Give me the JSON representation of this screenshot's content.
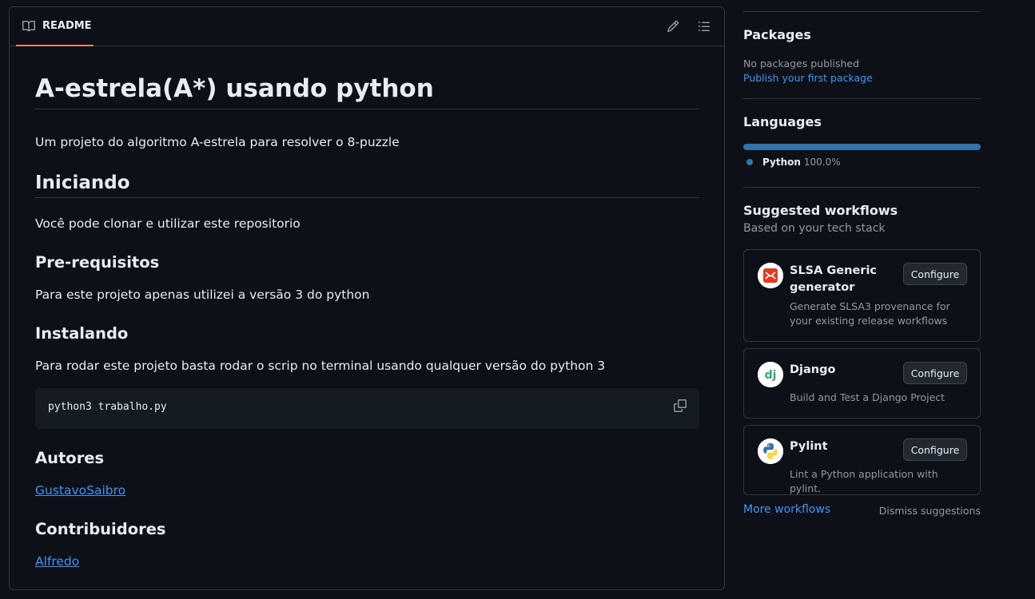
{
  "readme": {
    "tab_label": "README",
    "title": "A-estrela(A*) usando python",
    "intro": "Um projeto do algoritmo A-estrela para resolver o 8-puzzle",
    "h_iniciando": "Iniciando",
    "p_iniciando": "Você pode clonar e utilizar este repositorio",
    "h_prereq": "Pre-requisitos",
    "p_prereq": "Para este projeto apenas utilizei a versão 3 do python",
    "h_instalando": "Instalando",
    "p_instalando": "Para rodar este projeto basta rodar o scrip no terminal usando qualquer versão do python 3",
    "code": "python3 trabalho.py",
    "h_autores": "Autores",
    "author_link": "GustavoSaibro",
    "h_contrib": "Contribuidores",
    "contrib_link": "Alfredo"
  },
  "sidebar": {
    "packages_title": "Packages",
    "packages_empty": "No packages published",
    "packages_link": "Publish your first package",
    "languages_title": "Languages",
    "languages": [
      {
        "name": "Python",
        "percent": "100.0%",
        "color": "#3572A5"
      }
    ],
    "workflows_title": "Suggested workflows",
    "workflows_subtitle": "Based on your tech stack",
    "workflows": [
      {
        "name": "SLSA Generic generator",
        "desc": "Generate SLSA3 provenance for your existing release workflows",
        "button": "Configure",
        "icon": "slsa-icon"
      },
      {
        "name": "Django",
        "desc": "Build and Test a Django Project",
        "button": "Configure",
        "icon": "django-icon"
      },
      {
        "name": "Pylint",
        "desc": "Lint a Python application with pylint.",
        "button": "Configure",
        "icon": "python-icon"
      }
    ],
    "more_workflows": "More workflows",
    "dismiss": "Dismiss suggestions"
  },
  "colors": {
    "background": "#0d1117",
    "border": "#30363d",
    "link": "#4493f8",
    "tab_underline": "#f78166",
    "python": "#3572A5"
  }
}
